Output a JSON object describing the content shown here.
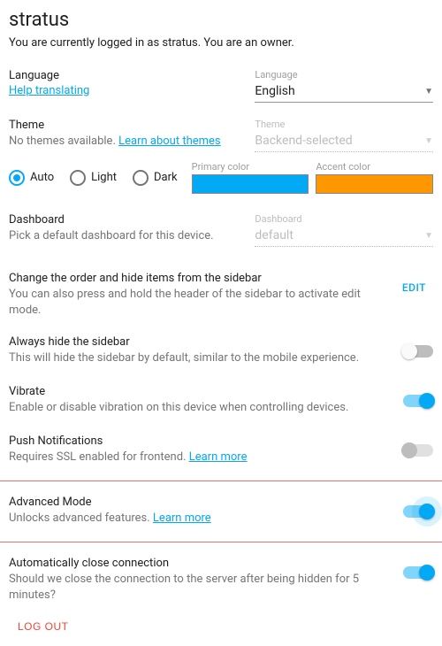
{
  "header": {
    "title": "stratus",
    "subtitle": "You are currently logged in as stratus. You are an owner."
  },
  "language": {
    "label": "Language",
    "help_link": "Help translating",
    "field_label": "Language",
    "value": "English"
  },
  "theme": {
    "label": "Theme",
    "no_themes": "No themes available. ",
    "learn_link": "Learn about themes",
    "field_label": "Theme",
    "value": "Backend-selected",
    "options": {
      "auto": "Auto",
      "light": "Light",
      "dark": "Dark"
    },
    "primary_label": "Primary color",
    "accent_label": "Accent color",
    "primary_color": "#03a9f4",
    "accent_color": "#ff9800"
  },
  "dashboard": {
    "label": "Dashboard",
    "desc": "Pick a default dashboard for this device.",
    "field_label": "Dashboard",
    "value": "default"
  },
  "sidebar_order": {
    "label": "Change the order and hide items from the sidebar",
    "desc": "You can also press and hold the header of the sidebar to activate edit mode.",
    "edit": "EDIT"
  },
  "hide_sidebar": {
    "label": "Always hide the sidebar",
    "desc": "This will hide the sidebar by default, similar to the mobile experience."
  },
  "vibrate": {
    "label": "Vibrate",
    "desc": "Enable or disable vibration on this device when controlling devices."
  },
  "push": {
    "label": "Push Notifications",
    "desc": "Requires SSL enabled for frontend. ",
    "learn_link": "Learn more"
  },
  "advanced": {
    "label": "Advanced Mode",
    "desc": "Unlocks advanced features. ",
    "learn_link": "Learn more"
  },
  "autoclose": {
    "label": "Automatically close connection",
    "desc": "Should we close the connection to the server after being hidden for 5 minutes?"
  },
  "logout": {
    "label": "LOG OUT"
  }
}
